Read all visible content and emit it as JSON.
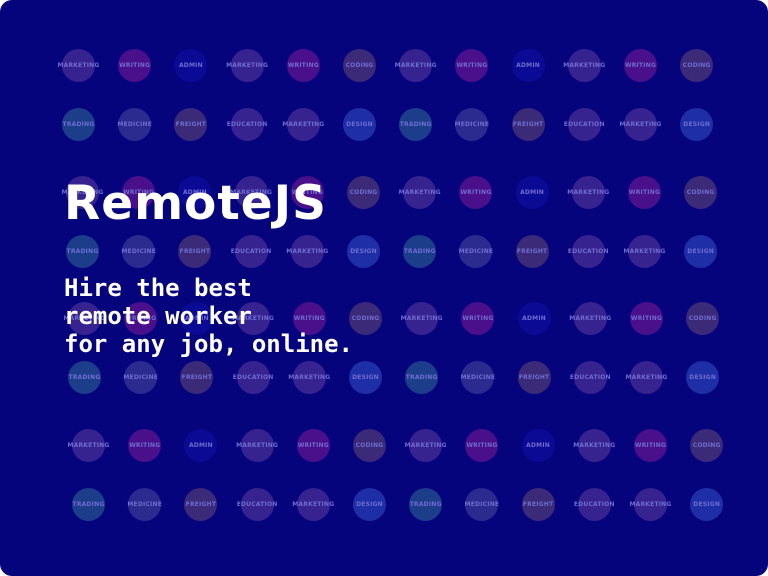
{
  "brand": {
    "title": "RemoteJS"
  },
  "hero": {
    "tagline_lines": [
      "Hire the best",
      "remote worker",
      "for any job, online."
    ]
  },
  "colors": {
    "background": "#05047d",
    "text": "#ffffff",
    "bubble_teal": "#1b3d8a",
    "bubble_purple": "#37238f",
    "bubble_slate": "#2b2a8e",
    "bubble_brown": "#3a2a78",
    "bubble_navy": "#0b0a95",
    "bubble_magenta": "#4a0f8a",
    "bubble_blue": "#1d2ea6",
    "bubble_green": "#0e4a84",
    "label_dim": "#6f6cd0"
  },
  "bubble_pattern_a": [
    "MARKETING",
    "WRITING",
    "ADMIN",
    "MARKETING",
    "WRITING",
    "CODING"
  ],
  "bubble_pattern_b": [
    "TRADING",
    "MEDICINE",
    "FREIGHT",
    "EDUCATION",
    "MARKETING",
    "DESIGN"
  ],
  "bubble_rows": [
    {
      "labels": [
        "MARKETING",
        "WRITING",
        "ADMIN",
        "MARKETING",
        "WRITING",
        "CODING",
        "MARKETING",
        "WRITING",
        "ADMIN",
        "MARKETING",
        "WRITING",
        "CODING"
      ]
    },
    {
      "labels": [
        "TRADING",
        "MEDICINE",
        "FREIGHT",
        "EDUCATION",
        "MARKETING",
        "DESIGN",
        "TRADING",
        "MEDICINE",
        "FREIGHT",
        "EDUCATION",
        "MARKETING",
        "DESIGN"
      ]
    },
    {
      "labels": [
        "MARKETING",
        "WRITING",
        "ADMIN",
        "MARKETING",
        "WRITING",
        "CODING",
        "MARKETING",
        "WRITING",
        "ADMIN",
        "MARKETING",
        "WRITING",
        "CODING"
      ]
    },
    {
      "labels": [
        "TRADING",
        "MEDICINE",
        "FREIGHT",
        "EDUCATION",
        "MARKETING",
        "DESIGN",
        "TRADING",
        "MEDICINE",
        "FREIGHT",
        "EDUCATION",
        "MARKETING",
        "DESIGN"
      ]
    },
    {
      "labels": [
        "MARKETING",
        "WRITING",
        "ADMIN",
        "MARKETING",
        "WRITING",
        "CODING",
        "MARKETING",
        "WRITING",
        "ADMIN",
        "MARKETING",
        "WRITING",
        "CODING"
      ]
    },
    {
      "labels": [
        "TRADING",
        "MEDICINE",
        "FREIGHT",
        "EDUCATION",
        "MARKETING",
        "DESIGN",
        "TRADING",
        "MEDICINE",
        "FREIGHT",
        "EDUCATION",
        "MARKETING",
        "DESIGN"
      ]
    },
    {
      "labels": [
        "MARKETING",
        "WRITING",
        "ADMIN",
        "MARKETING",
        "WRITING",
        "CODING",
        "MARKETING",
        "WRITING",
        "ADMIN",
        "MARKETING",
        "WRITING",
        "CODING"
      ]
    },
    {
      "labels": [
        "TRADING",
        "MEDICINE",
        "FREIGHT",
        "EDUCATION",
        "MARKETING",
        "DESIGN",
        "TRADING",
        "MEDICINE",
        "FREIGHT",
        "EDUCATION",
        "MARKETING",
        "DESIGN"
      ]
    }
  ]
}
